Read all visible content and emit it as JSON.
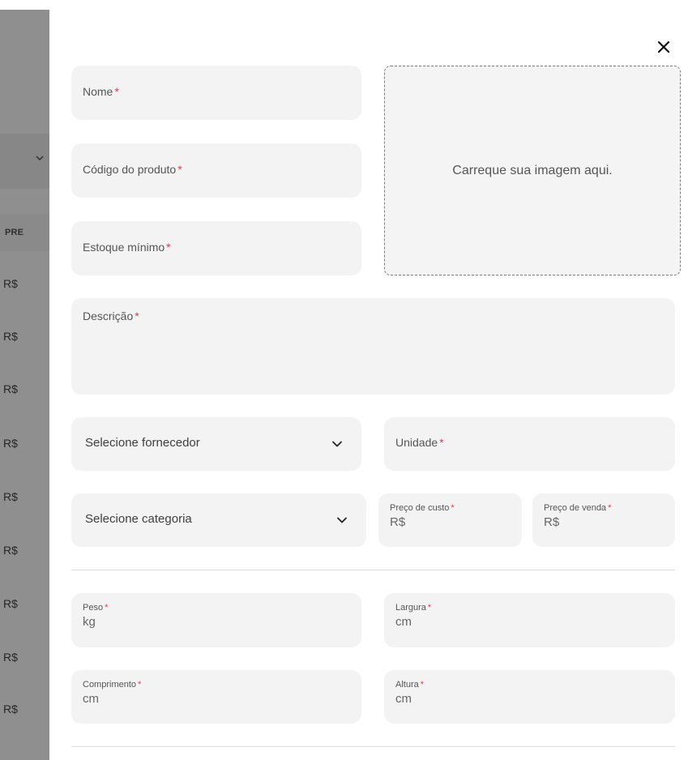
{
  "background": {
    "column_header": "PRE",
    "cell_text": "R$",
    "rows": [
      "R$",
      "R$",
      "R$",
      "R$",
      "R$",
      "R$",
      "R$",
      "R$",
      "R$"
    ]
  },
  "modal": {
    "close_icon": "close-icon",
    "upload_text": "Carreque sua imagem aqui.",
    "required_mark": "*",
    "fields": {
      "nome": "Nome",
      "codigo": "Código do produto",
      "estoque": "Estoque mínimo",
      "descricao": "Descrição",
      "unidade": "Unidade",
      "preco_custo": "Preço de custo",
      "preco_custo_prefix": "R$",
      "preco_venda": "Preço de venda",
      "preco_venda_prefix": "R$",
      "peso": "Peso",
      "peso_unit": "kg",
      "largura": "Largura",
      "largura_unit": "cm",
      "comprimento": "Comprimento",
      "comprimento_unit": "cm",
      "altura": "Altura",
      "altura_unit": "cm"
    },
    "selects": {
      "fornecedor": "Selecione fornecedor",
      "categoria": "Selecione categoria"
    },
    "colors": {
      "required": "#e53950",
      "field_bg": "#f3f3f3",
      "overlay": "#8f8f8f"
    }
  }
}
